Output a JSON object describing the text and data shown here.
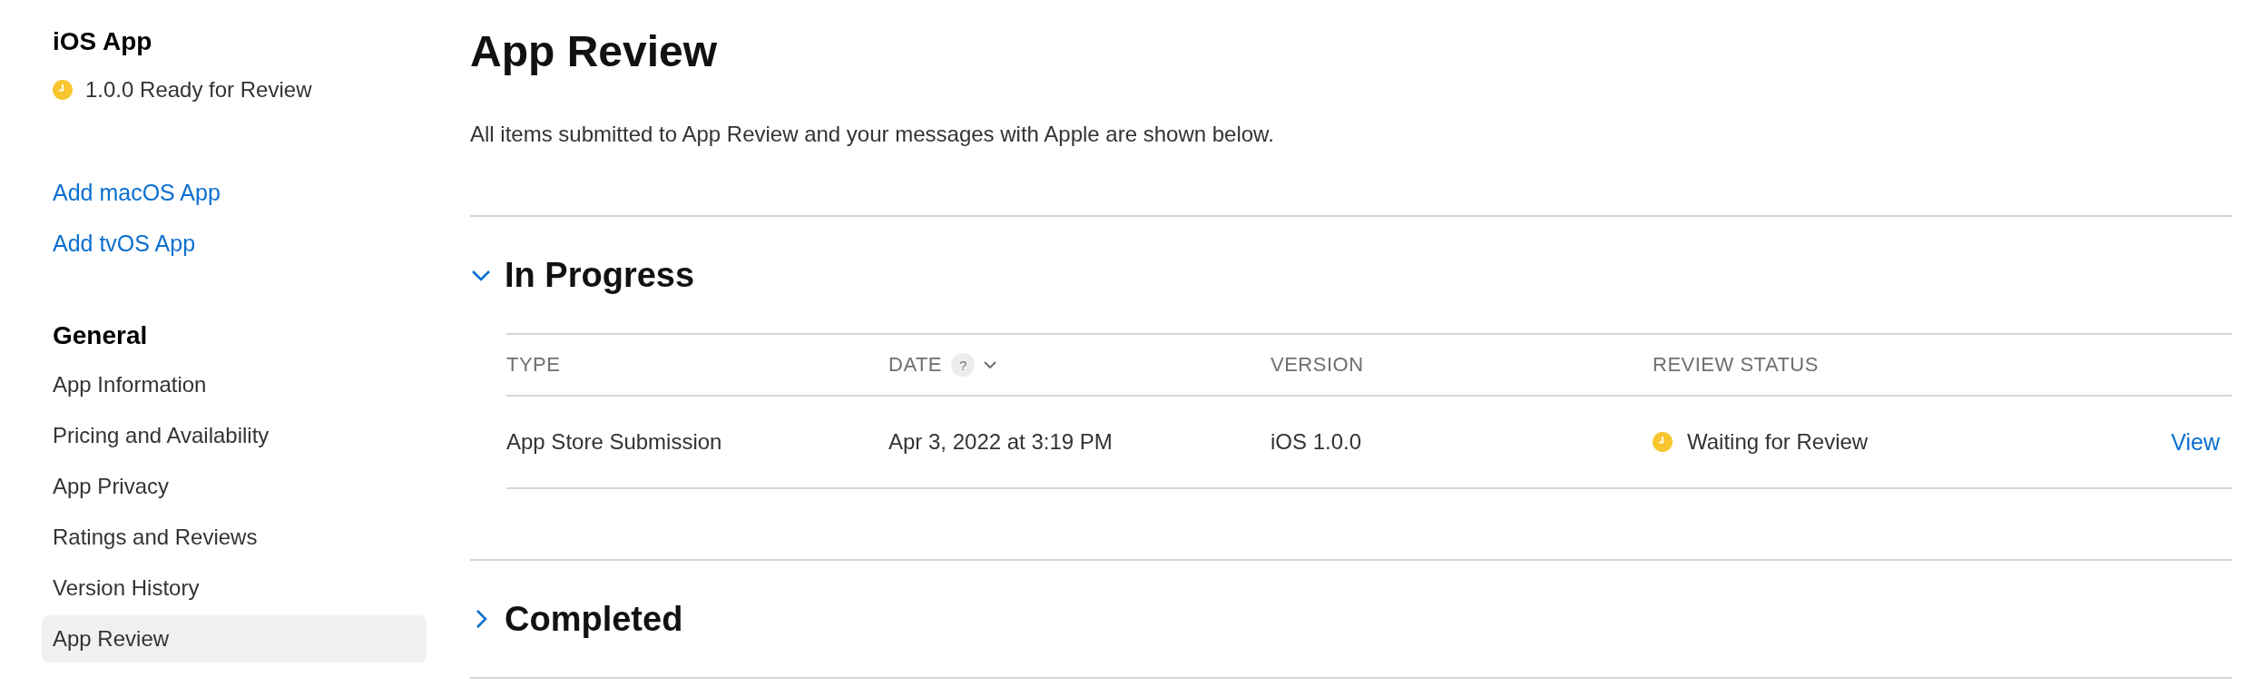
{
  "sidebar": {
    "app_title": "iOS App",
    "app_status": "1.0.0 Ready for Review",
    "links": [
      "Add macOS App",
      "Add tvOS App"
    ],
    "section_title": "General",
    "items": [
      {
        "label": "App Information",
        "selected": false
      },
      {
        "label": "Pricing and Availability",
        "selected": false
      },
      {
        "label": "App Privacy",
        "selected": false
      },
      {
        "label": "Ratings and Reviews",
        "selected": false
      },
      {
        "label": "Version History",
        "selected": false
      },
      {
        "label": "App Review",
        "selected": true
      }
    ]
  },
  "main": {
    "title": "App Review",
    "description": "All items submitted to App Review and your messages with Apple are shown below.",
    "sections": [
      {
        "title": "In Progress",
        "expanded": true,
        "table": {
          "columns": [
            {
              "label": "TYPE",
              "sorted": false
            },
            {
              "label": "DATE",
              "help": "?",
              "sorted": true
            },
            {
              "label": "VERSION",
              "sorted": false
            },
            {
              "label": "REVIEW STATUS",
              "sorted": false
            }
          ],
          "rows": [
            {
              "type": "App Store Submission",
              "date": "Apr 3, 2022 at 3:19 PM",
              "version": "iOS 1.0.0",
              "review_status": "Waiting for Review",
              "action": "View"
            }
          ]
        }
      },
      {
        "title": "Completed",
        "expanded": false
      }
    ]
  }
}
